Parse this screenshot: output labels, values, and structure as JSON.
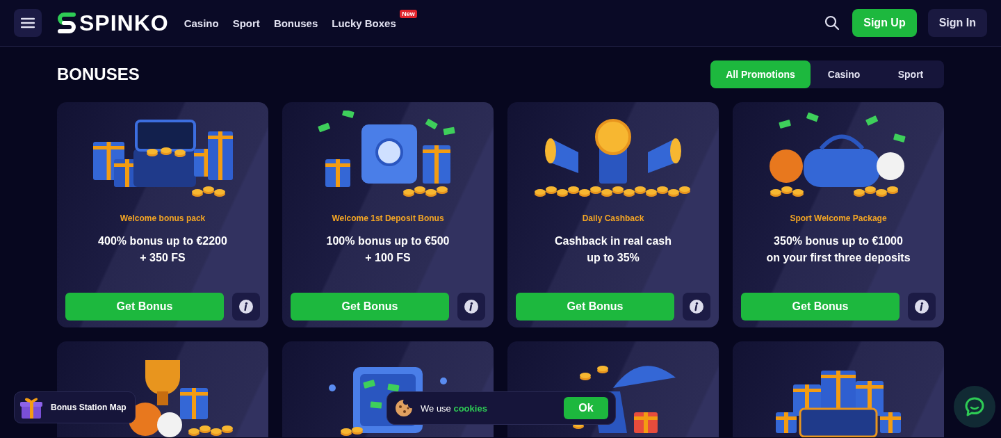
{
  "header": {
    "brand": "SPINKO",
    "nav": [
      {
        "label": "Casino"
      },
      {
        "label": "Sport"
      },
      {
        "label": "Bonuses"
      },
      {
        "label": "Lucky Boxes",
        "badge": "New"
      }
    ],
    "sign_up": "Sign Up",
    "sign_in": "Sign In"
  },
  "page": {
    "title": "BONUSES",
    "filters": [
      {
        "label": "All Promotions",
        "selected": true
      },
      {
        "label": "Casino",
        "selected": false
      },
      {
        "label": "Sport",
        "selected": false
      }
    ]
  },
  "cards": [
    {
      "kind": "gifts",
      "tag": "Welcome bonus pack",
      "headline": "400% bonus up to €2200\n+ 350 FS",
      "button": "Get Bonus"
    },
    {
      "kind": "safe",
      "tag": "Welcome 1st Deposit Bonus",
      "headline": "100% bonus up to €500\n+ 100 FS",
      "button": "Get Bonus"
    },
    {
      "kind": "megaphones",
      "tag": "Daily Cashback",
      "headline": "Cashback in real cash\nup to 35%",
      "button": "Get Bonus"
    },
    {
      "kind": "bag",
      "tag": "Sport Welcome Package",
      "headline": "350% bonus up to €1000\non your first three deposits",
      "button": "Get Bonus"
    },
    {
      "kind": "trophy"
    },
    {
      "kind": "suitcase"
    },
    {
      "kind": "beach"
    },
    {
      "kind": "basket"
    }
  ],
  "bonus_map": {
    "label": "Bonus Station Map"
  },
  "cookie": {
    "text": "We use **cookies**",
    "button": "Ok"
  }
}
